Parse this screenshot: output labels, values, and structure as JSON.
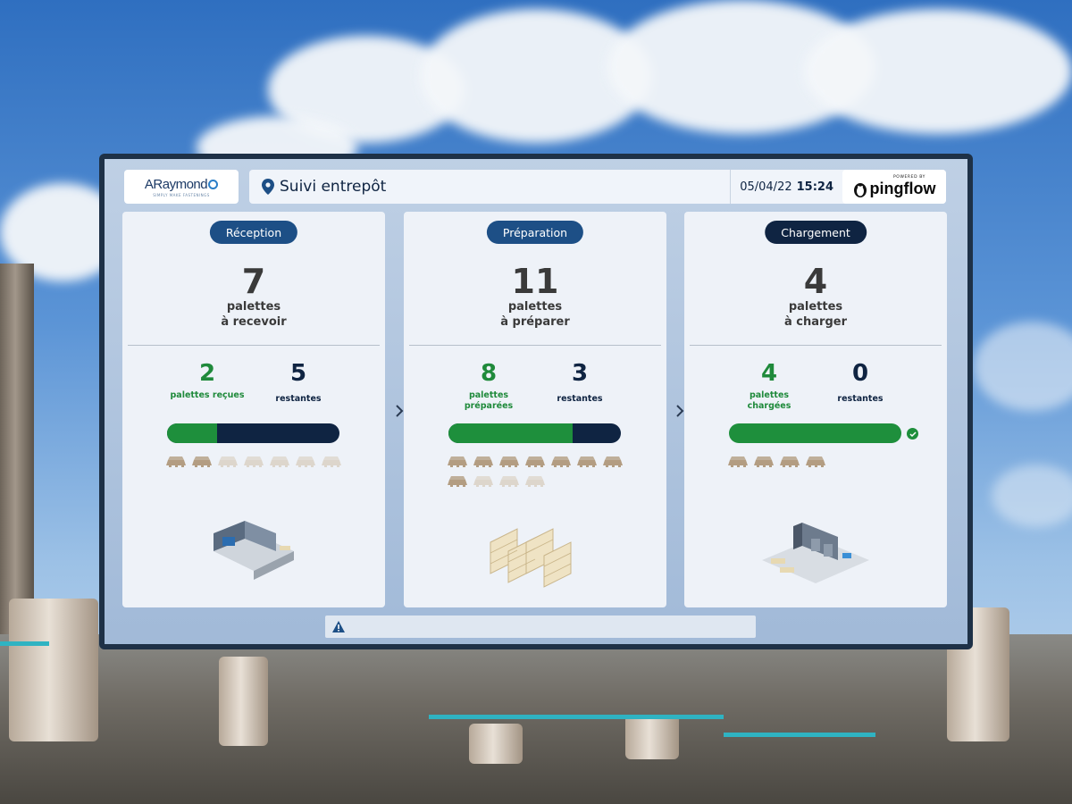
{
  "header": {
    "logo_text": "ARaymond",
    "logo_tagline": "SIMPLY MAKE FASTENINGS",
    "title": "Suivi entrepôt",
    "date": "05/04/22",
    "time": "15:24",
    "brand_powered": "POWERED BY",
    "brand_name": "pingflow"
  },
  "panels": [
    {
      "pill": "Réception",
      "pill_color": "#1d4f86",
      "total": "7",
      "total_label_1": "palettes",
      "total_label_2": "à recevoir",
      "done": "2",
      "done_label_1": "palettes reçues",
      "done_label_2": "",
      "remaining": "5",
      "remaining_label": "restantes",
      "progress": 0.29,
      "pallets_done": 2,
      "pallets_total": 7,
      "complete": false
    },
    {
      "pill": "Préparation",
      "pill_color": "#1d4f86",
      "total": "11",
      "total_label_1": "palettes",
      "total_label_2": "à préparer",
      "done": "8",
      "done_label_1": "palettes",
      "done_label_2": "préparées",
      "remaining": "3",
      "remaining_label": "restantes",
      "progress": 0.72,
      "pallets_done": 8,
      "pallets_total": 11,
      "complete": false
    },
    {
      "pill": "Chargement",
      "pill_color": "#0f2442",
      "total": "4",
      "total_label_1": "palettes",
      "total_label_2": "à charger",
      "done": "4",
      "done_label_1": "palettes",
      "done_label_2": "chargées",
      "remaining": "0",
      "remaining_label": "restantes",
      "progress": 1.0,
      "pallets_done": 4,
      "pallets_total": 4,
      "complete": true
    }
  ],
  "colors": {
    "done_green": "#1e8f3c",
    "remaining_navy": "#0f2442",
    "pallet_done": "#b39d82",
    "pallet_pending": "#ddd6cc"
  },
  "icons": {
    "location": "map-pin-icon",
    "alert": "warning-icon",
    "complete": "check-circle-icon",
    "next": "chevron-right-icon"
  }
}
